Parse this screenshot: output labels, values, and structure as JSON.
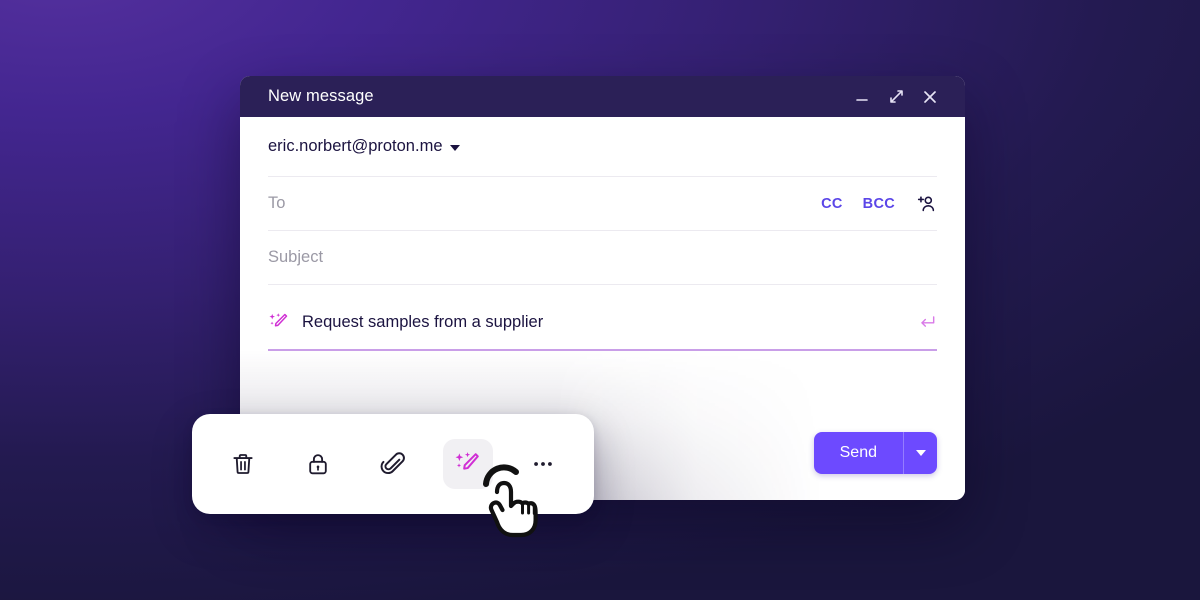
{
  "background": {
    "gradient_from": "#54309e",
    "gradient_to": "#1a163d"
  },
  "window": {
    "title": "New message",
    "titlebar_color": "#2b2057",
    "controls": [
      {
        "name": "minimize-button",
        "icon": "minimize-icon",
        "label": "Minimize"
      },
      {
        "name": "maximize-button",
        "icon": "expand-icon",
        "label": "Maximize"
      },
      {
        "name": "close-button",
        "icon": "close-icon",
        "label": "Close"
      }
    ]
  },
  "compose": {
    "from": {
      "address": "eric.norbert@proton.me",
      "has_dropdown": true
    },
    "to": {
      "placeholder": "To",
      "value": ""
    },
    "cc_label": "CC",
    "bcc_label": "BCC",
    "contacts_icon": "add-contact-icon",
    "subject": {
      "placeholder": "Subject",
      "value": ""
    },
    "ai_prompt": {
      "icon": "magic-wand-icon",
      "value": "Request samples from a supplier",
      "submit_icon": "enter-key-icon",
      "underline_color": "#c99ee8",
      "accent_color": "#d02fd4"
    },
    "send": {
      "label": "Send",
      "color": "#6d4aff",
      "has_dropdown": true
    }
  },
  "toolbar": {
    "items": [
      {
        "name": "delete-draft-button",
        "icon": "trash-icon",
        "label": "Delete draft",
        "active": false
      },
      {
        "name": "encryption-button",
        "icon": "lock-icon",
        "label": "Encryption",
        "active": false
      },
      {
        "name": "attachment-button",
        "icon": "paperclip-icon",
        "label": "Attachments",
        "active": false
      },
      {
        "name": "ai-writing-assistant-button",
        "icon": "magic-wand-icon",
        "label": "Writing assistant",
        "active": true
      },
      {
        "name": "more-options-button",
        "icon": "ellipsis-icon",
        "label": "More options",
        "active": false
      }
    ]
  },
  "cursor": {
    "icon": "pointing-hand-cursor",
    "state": "clicking"
  }
}
